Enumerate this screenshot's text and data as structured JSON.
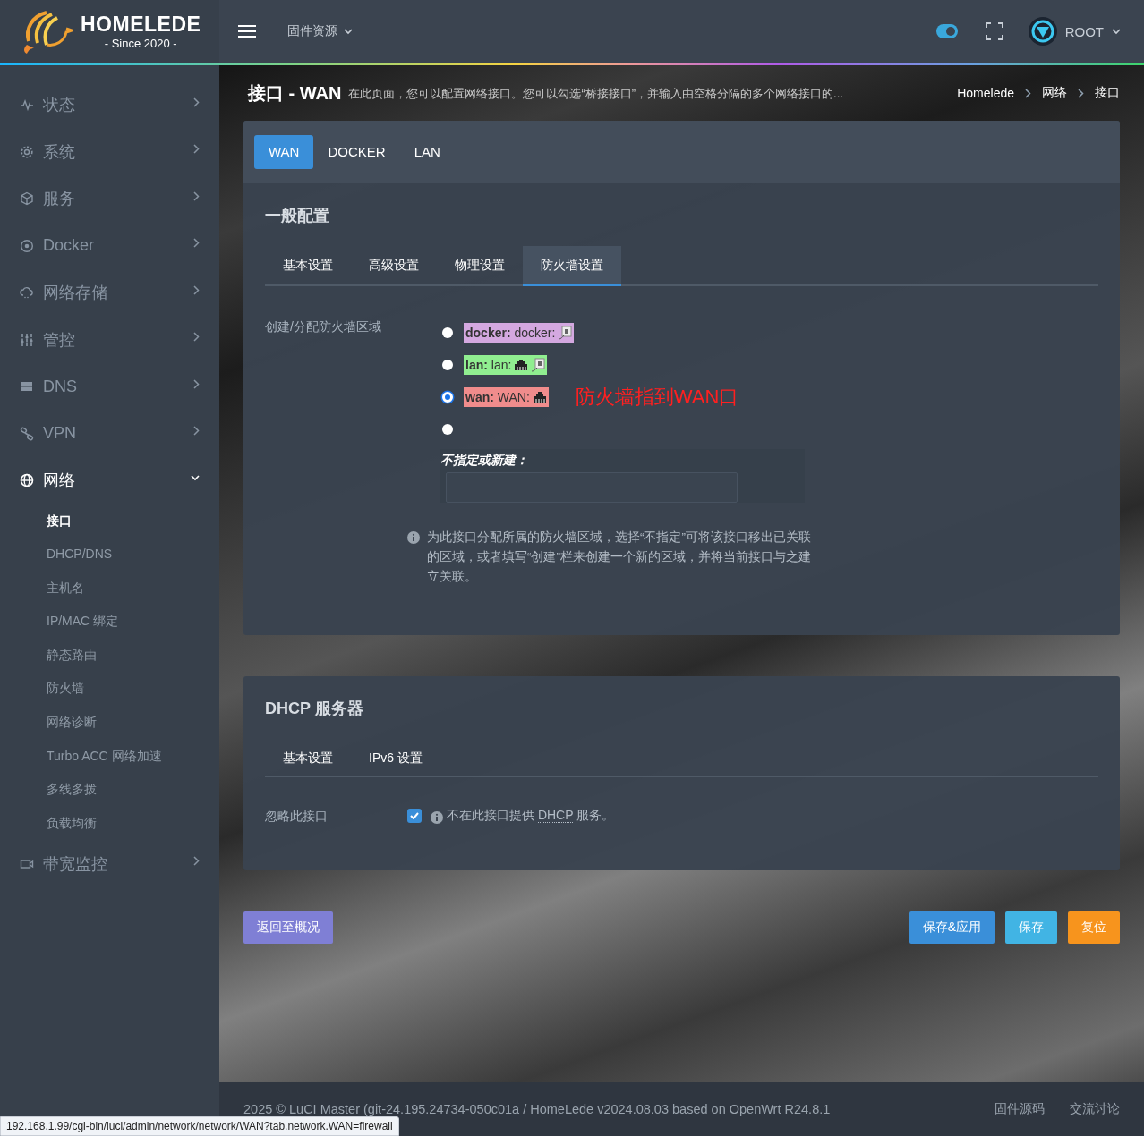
{
  "header": {
    "logo": {
      "title": "HOMELEDE",
      "subtitle": "- Since 2020 -"
    },
    "menu": {
      "label": "固件资源"
    },
    "theme_toggle": {
      "on": true
    },
    "user": {
      "label": "ROOT"
    }
  },
  "sidebar": {
    "items": [
      {
        "label": "状态",
        "expanded": false
      },
      {
        "label": "系统",
        "expanded": false
      },
      {
        "label": "服务",
        "expanded": false
      },
      {
        "label": "Docker",
        "expanded": false
      },
      {
        "label": "网络存储",
        "expanded": false
      },
      {
        "label": "管控",
        "expanded": false
      },
      {
        "label": "DNS",
        "expanded": false
      },
      {
        "label": "VPN",
        "expanded": false
      },
      {
        "label": "网络",
        "expanded": true,
        "children": [
          {
            "label": "接口",
            "selected": true
          },
          {
            "label": "DHCP/DNS",
            "selected": false
          },
          {
            "label": "主机名",
            "selected": false
          },
          {
            "label": "IP/MAC 绑定",
            "selected": false
          },
          {
            "label": "静态路由",
            "selected": false
          },
          {
            "label": "防火墙",
            "selected": false
          },
          {
            "label": "网络诊断",
            "selected": false
          },
          {
            "label": "Turbo ACC 网络加速",
            "selected": false
          },
          {
            "label": "多线多拨",
            "selected": false
          },
          {
            "label": "负载均衡",
            "selected": false
          }
        ]
      },
      {
        "label": "带宽监控",
        "expanded": false
      }
    ]
  },
  "page": {
    "title": "接口 - WAN",
    "description": "在此页面，您可以配置网络接口。您可以勾选“桥接接口”，并输入由空格分隔的多个网络接口的...",
    "breadcrumb": [
      {
        "label": "Homelede"
      },
      {
        "label": "网络"
      },
      {
        "label": "接口"
      }
    ]
  },
  "interface_tabs": [
    {
      "label": "WAN",
      "selected": true
    },
    {
      "label": "DOCKER",
      "selected": false
    },
    {
      "label": "LAN",
      "selected": false
    }
  ],
  "general": {
    "title": "一般配置",
    "tabs": [
      {
        "label": "基本设置",
        "selected": false
      },
      {
        "label": "高级设置",
        "selected": false
      },
      {
        "label": "物理设置",
        "selected": false
      },
      {
        "label": "防火墙设置",
        "selected": true
      }
    ],
    "field": {
      "label": "创建/分配防火墙区域",
      "options": [
        {
          "kind": "zone",
          "text": "**docker:** docker:",
          "color": "#d4a8e0",
          "selected": false
        },
        {
          "kind": "zone",
          "text": "**lan:** lan:",
          "color": "#90ee90",
          "selected": false
        },
        {
          "kind": "zone",
          "text": "**wan:** WAN:",
          "color": "#f08c8c",
          "selected": true,
          "annotation": "防火墙指到WAN口"
        },
        {
          "kind": "custom",
          "label": "不指定或新建：",
          "selected": false
        }
      ],
      "help": "为此接口分配所属的防火墙区域，选择“不指定”可将该接口移出已关联的区域，或者填写“创建”栏来创建一个新的区域，并将当前接口与之建立关联。"
    }
  },
  "dhcp": {
    "title": "DHCP 服务器",
    "tabs": [
      {
        "label": "基本设置",
        "selected": false
      },
      {
        "label": "IPv6 设置",
        "selected": false
      }
    ],
    "field": {
      "label": "忽略此接口",
      "checked": true,
      "help_before": "不在此接口提供",
      "help_abbr": "DHCP",
      "help_after": "服务。"
    }
  },
  "actions": {
    "left": [
      {
        "label": "返回至概况",
        "kind": "back"
      }
    ],
    "right": [
      {
        "label": "保存&应用",
        "kind": "apply"
      },
      {
        "label": "保存",
        "kind": "save"
      },
      {
        "label": "复位",
        "kind": "reset"
      }
    ]
  },
  "footer": {
    "text": "2025 © LuCI Master (git-24.195.24734-050c01a / HomeLede v2024.08.03 based on OpenWrt R24.8.1",
    "links": [
      {
        "label": "固件源码"
      },
      {
        "label": "交流讨论"
      }
    ]
  },
  "status_url": "192.168.1.99/cgi-bin/luci/admin/network/network/WAN?tab.network.WAN=firewall"
}
